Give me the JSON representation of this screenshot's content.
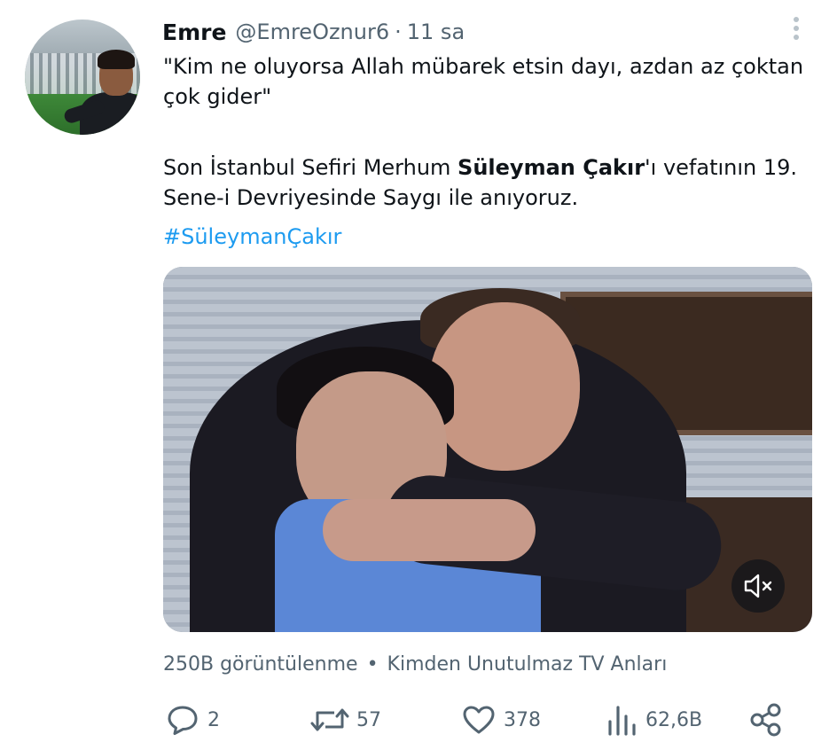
{
  "tweet": {
    "author_name": "Emre",
    "handle": "@EmreOznur6",
    "separator": "·",
    "time": "11 sa",
    "quote_text": "\"Kim ne oluyorsa Allah mübarek etsin dayı, azdan az çoktan çok gider\"",
    "body_prefix": "Son İstanbul Sefiri Merhum ",
    "body_bold": "Süleyman Çakır",
    "body_suffix": "'ı vefatının 19. Sene-i Devriyesinde Saygı ile anıyoruz.",
    "hashtag": "#SüleymanÇakır"
  },
  "meta": {
    "views": "250B görüntülenme",
    "dot": "•",
    "source": "Kimden  Unutulmaz TV Anları"
  },
  "actions": {
    "replies": "2",
    "retweets": "57",
    "likes": "378",
    "views": "62,6B"
  },
  "icons": {
    "more": "more-vertical-icon",
    "mute": "speaker-muted-icon",
    "reply": "reply-icon",
    "retweet": "retweet-icon",
    "like": "heart-icon",
    "views": "bar-chart-icon",
    "share": "share-icon"
  },
  "colors": {
    "text": "#0f1419",
    "secondary": "#536471",
    "link": "#1d9bf0"
  }
}
